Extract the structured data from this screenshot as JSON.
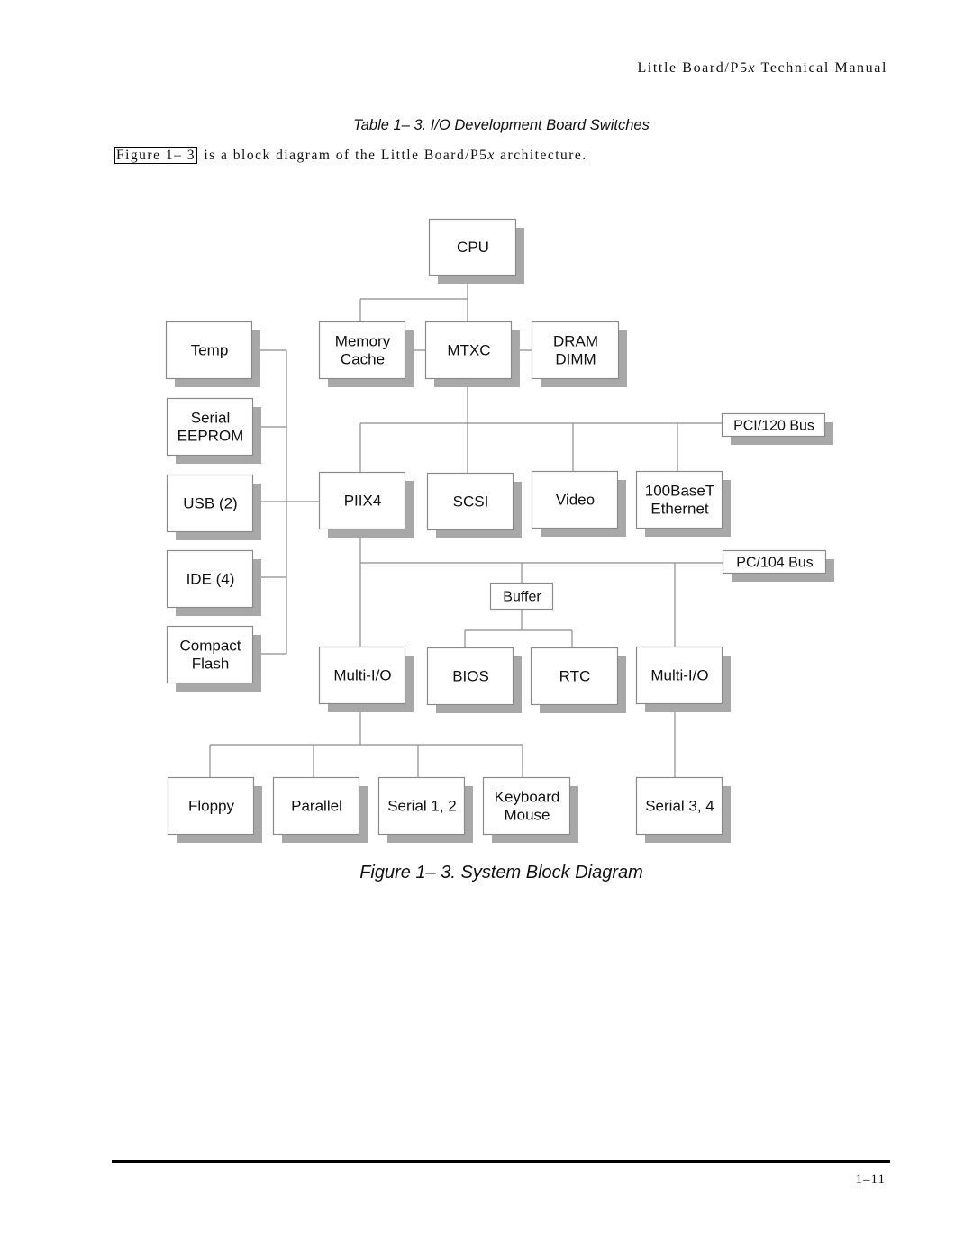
{
  "header": {
    "title_prefix": "Little Board/P5",
    "title_italic": "x",
    "title_suffix": " Technical Manual"
  },
  "table_caption": "Table 1– 3. I/O Development Board Switches",
  "intro": {
    "xref": "Figure 1– 3",
    "text_before_italic": " is a block diagram of the Little Board/P5",
    "italic": "x",
    "text_after_italic": " architecture."
  },
  "diagram": {
    "blocks": [
      {
        "id": "cpu",
        "lines": [
          "CPU"
        ]
      },
      {
        "id": "memory-cache",
        "lines": [
          "Memory",
          "Cache"
        ]
      },
      {
        "id": "mtxc",
        "lines": [
          "MTXC"
        ]
      },
      {
        "id": "dram-dimm",
        "lines": [
          "DRAM",
          "DIMM"
        ]
      },
      {
        "id": "temp",
        "lines": [
          "Temp"
        ]
      },
      {
        "id": "serial-eeprom",
        "lines": [
          "Serial",
          "EEPROM"
        ]
      },
      {
        "id": "usb",
        "lines": [
          "USB (2)"
        ]
      },
      {
        "id": "ide",
        "lines": [
          "IDE (4)"
        ]
      },
      {
        "id": "compact-flash",
        "lines": [
          "Compact",
          "Flash"
        ]
      },
      {
        "id": "piix4",
        "lines": [
          "PIIX4"
        ]
      },
      {
        "id": "scsi",
        "lines": [
          "SCSI"
        ]
      },
      {
        "id": "video",
        "lines": [
          "Video"
        ]
      },
      {
        "id": "ethernet",
        "lines": [
          "100BaseT",
          "Ethernet"
        ]
      },
      {
        "id": "pci-bus",
        "lines": [
          "PCI/120 Bus"
        ]
      },
      {
        "id": "pc104-bus",
        "lines": [
          "PC/104 Bus"
        ]
      },
      {
        "id": "buffer",
        "lines": [
          "Buffer"
        ]
      },
      {
        "id": "multi-io-1",
        "lines": [
          "Multi-I/O"
        ]
      },
      {
        "id": "bios",
        "lines": [
          "BIOS"
        ]
      },
      {
        "id": "rtc",
        "lines": [
          "RTC"
        ]
      },
      {
        "id": "multi-io-2",
        "lines": [
          "Multi-I/O"
        ]
      },
      {
        "id": "floppy",
        "lines": [
          "Floppy"
        ]
      },
      {
        "id": "parallel",
        "lines": [
          "Parallel"
        ]
      },
      {
        "id": "serial-1-2",
        "lines": [
          "Serial 1, 2"
        ]
      },
      {
        "id": "keyboard-mouse",
        "lines": [
          "Keyboard",
          "Mouse"
        ]
      },
      {
        "id": "serial-3-4",
        "lines": [
          "Serial 3, 4"
        ]
      }
    ],
    "connections": [
      [
        "cpu",
        "mtxc"
      ],
      [
        "cpu",
        "memory-cache"
      ],
      [
        "memory-cache",
        "mtxc"
      ],
      [
        "mtxc",
        "dram-dimm"
      ],
      [
        "mtxc",
        "pci-bus"
      ],
      [
        "pci-bus",
        "piix4"
      ],
      [
        "pci-bus",
        "scsi"
      ],
      [
        "pci-bus",
        "video"
      ],
      [
        "pci-bus",
        "ethernet"
      ],
      [
        "piix4",
        "temp"
      ],
      [
        "piix4",
        "serial-eeprom"
      ],
      [
        "piix4",
        "usb"
      ],
      [
        "piix4",
        "ide"
      ],
      [
        "piix4",
        "compact-flash"
      ],
      [
        "piix4",
        "pc104-bus"
      ],
      [
        "pc104-bus",
        "multi-io-1"
      ],
      [
        "pc104-bus",
        "buffer"
      ],
      [
        "pc104-bus",
        "multi-io-2"
      ],
      [
        "buffer",
        "bios"
      ],
      [
        "buffer",
        "rtc"
      ],
      [
        "multi-io-1",
        "floppy"
      ],
      [
        "multi-io-1",
        "parallel"
      ],
      [
        "multi-io-1",
        "serial-1-2"
      ],
      [
        "multi-io-1",
        "keyboard-mouse"
      ],
      [
        "multi-io-2",
        "serial-3-4"
      ]
    ]
  },
  "figure_caption": "Figure 1– 3. System Block Diagram",
  "footer": {
    "page_number": "1–11"
  }
}
